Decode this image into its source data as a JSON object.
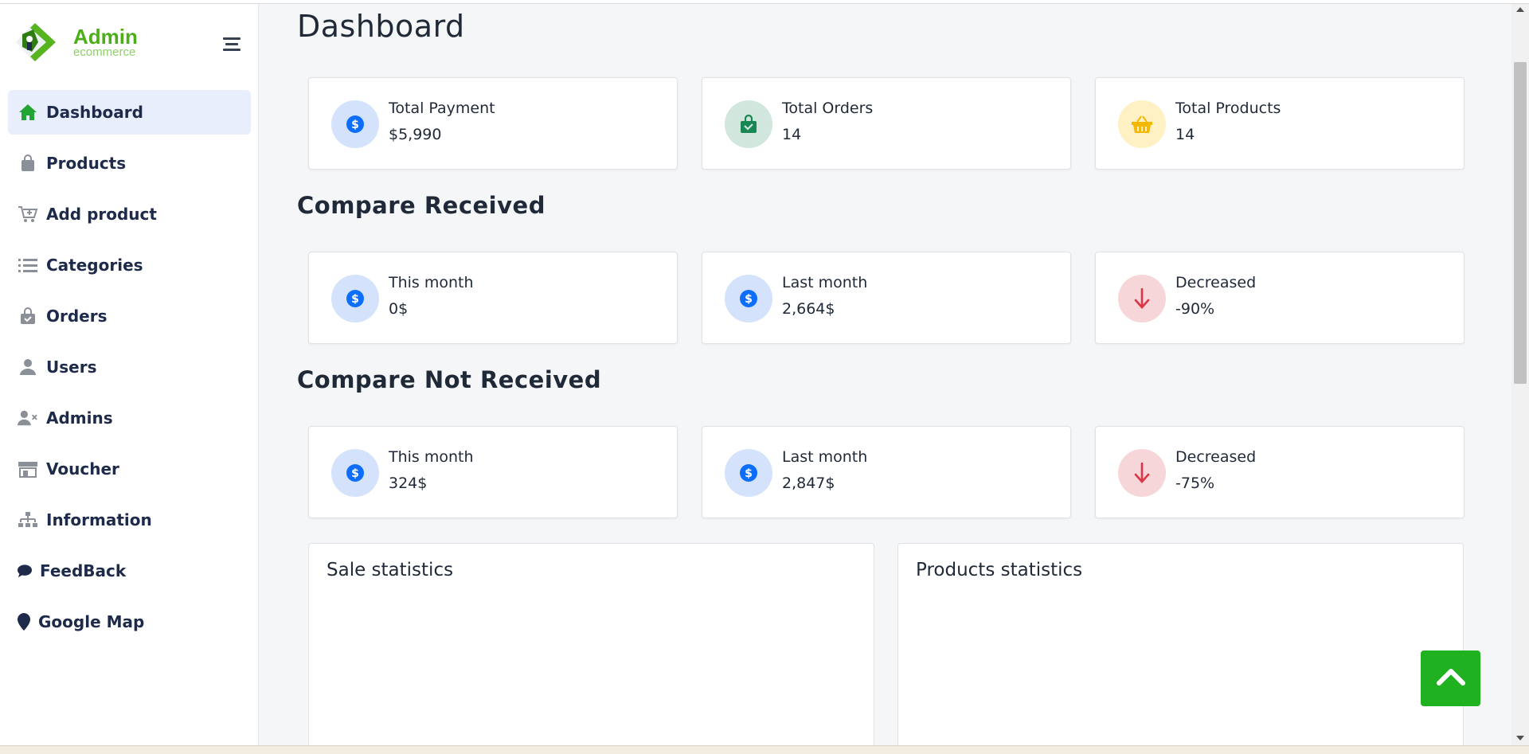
{
  "colors": {
    "brand_green": "#4caf1a",
    "accent_blue": "#0d6efd",
    "success_green": "#1fb11f",
    "danger_red": "#dc3545",
    "warning_yellow": "#f5c000",
    "nav_text": "#1e2a4a"
  },
  "logo": {
    "title": "Admin",
    "subtitle": "ecommerce"
  },
  "sidebar": {
    "items": [
      {
        "label": "Dashboard",
        "icon": "home-icon",
        "active": true
      },
      {
        "label": "Products",
        "icon": "shopping-bag-icon"
      },
      {
        "label": "Add product",
        "icon": "cart-plus-icon"
      },
      {
        "label": "Categories",
        "icon": "list-icon"
      },
      {
        "label": "Orders",
        "icon": "bag-check-icon"
      },
      {
        "label": "Users",
        "icon": "user-icon"
      },
      {
        "label": "Admins",
        "icon": "user-x-icon"
      },
      {
        "label": "Voucher",
        "icon": "store-icon"
      },
      {
        "label": "Information",
        "icon": "sitemap-icon"
      },
      {
        "label": "FeedBack",
        "icon": "comment-icon"
      },
      {
        "label": "Google Map",
        "icon": "map-pin-icon"
      }
    ]
  },
  "main": {
    "title": "Dashboard",
    "overview": [
      {
        "label": "Total Payment",
        "value": "$5,990",
        "icon": "dollar-circle-icon"
      },
      {
        "label": "Total Orders",
        "value": "14",
        "icon": "bag-check-icon"
      },
      {
        "label": "Total Products",
        "value": "14",
        "icon": "basket-icon"
      }
    ],
    "received": {
      "title": "Compare Received",
      "cards": [
        {
          "label": "This month",
          "value": "0$",
          "icon": "dollar-circle-icon"
        },
        {
          "label": "Last month",
          "value": "2,664$",
          "icon": "dollar-circle-icon"
        },
        {
          "label": "Decreased",
          "value": "-90%",
          "icon": "arrow-down-icon"
        }
      ]
    },
    "not_received": {
      "title": "Compare Not Received",
      "cards": [
        {
          "label": "This month",
          "value": "324$",
          "icon": "dollar-circle-icon"
        },
        {
          "label": "Last month",
          "value": "2,847$",
          "icon": "dollar-circle-icon"
        },
        {
          "label": "Decreased",
          "value": "-75%",
          "icon": "arrow-down-icon"
        }
      ]
    },
    "panels": [
      {
        "title": "Sale statistics"
      },
      {
        "title": "Products statistics"
      }
    ]
  },
  "scroll_top": {
    "icon": "chevron-up-icon"
  }
}
